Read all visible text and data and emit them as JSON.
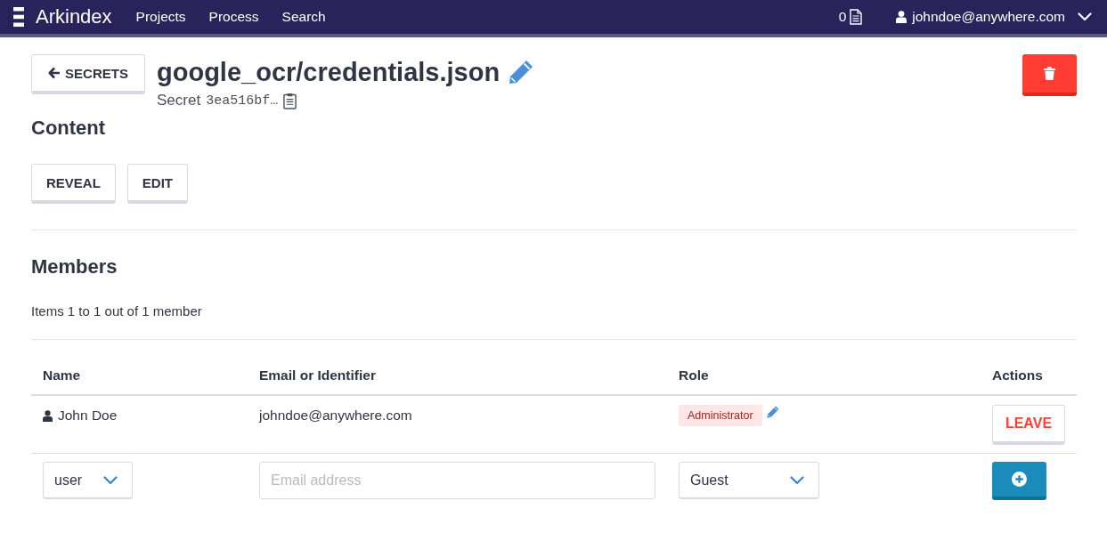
{
  "navbar": {
    "brand": "Arkindex",
    "links": [
      "Projects",
      "Process",
      "Search"
    ],
    "notifications": "0",
    "user": "johndoe@anywhere.com"
  },
  "header": {
    "back_button": "SECRETS",
    "title": "google_ocr/credentials.json",
    "subtitle_label": "Secret",
    "secret_id": "3ea516bf…"
  },
  "content": {
    "heading": "Content",
    "buttons": [
      "REVEAL",
      "EDIT"
    ]
  },
  "members": {
    "heading": "Members",
    "count_text": "Items 1 to 1 out of 1 member",
    "columns": [
      "Name",
      "Email or Identifier",
      "Role",
      "Actions"
    ],
    "rows": [
      {
        "name": "John Doe",
        "email": "johndoe@anywhere.com",
        "role": "Administrator",
        "action": "LEAVE"
      }
    ],
    "add_form": {
      "type": "user",
      "email_placeholder": "Email address",
      "role": "Guest"
    }
  }
}
